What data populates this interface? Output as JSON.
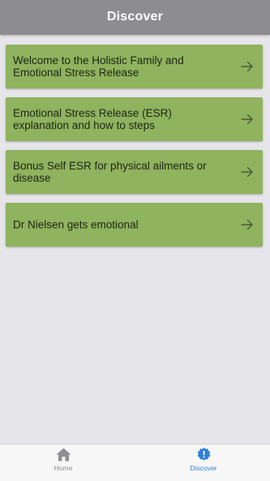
{
  "header": {
    "title": "Discover"
  },
  "items": [
    {
      "label": "Welcome to the Holistic Family and Emotional Stress Release",
      "icon": "arrow-right-icon"
    },
    {
      "label": "Emotional Stress Release (ESR) explanation and how to steps",
      "icon": "arrow-right-icon"
    },
    {
      "label": "Bonus Self ESR for physical ailments or disease",
      "icon": "arrow-right-icon"
    },
    {
      "label": "Dr Nielsen gets emotional",
      "icon": "arrow-right-icon"
    }
  ],
  "tabbar": {
    "tabs": [
      {
        "label": "Home",
        "icon": "home-icon",
        "active": false
      },
      {
        "label": "Discover",
        "icon": "discover-badge-icon",
        "active": true
      }
    ]
  },
  "colors": {
    "header_bg": "#8d8c91",
    "card_bg": "#8fb35e",
    "page_bg": "#e6e5ea",
    "active_tab": "#2f7fd8",
    "inactive_tab": "#8e8e93"
  }
}
